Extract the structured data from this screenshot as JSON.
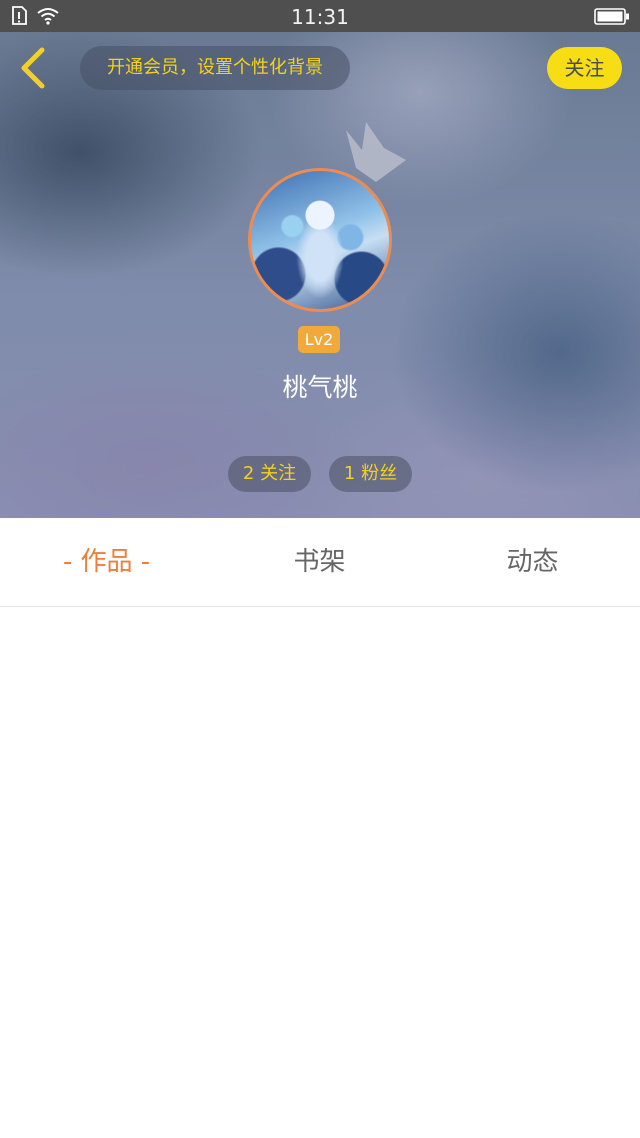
{
  "status_bar": {
    "time": "11:31"
  },
  "header": {
    "vip_banner": "开通会员，设置个性化背景",
    "follow_label": "关注",
    "level": "Lv2",
    "username": "桃气桃",
    "following_count": "2 关注",
    "fans_count": "1 粉丝"
  },
  "tabs": [
    {
      "label": "- 作品 -",
      "active": true
    },
    {
      "label": "书架",
      "active": false
    },
    {
      "label": "动态",
      "active": false
    }
  ],
  "colors": {
    "accent_yellow": "#f4d21a",
    "active_tab": "#ee7f3b",
    "avatar_ring": "#ec8c52",
    "level_badge": "#f2a93b"
  }
}
